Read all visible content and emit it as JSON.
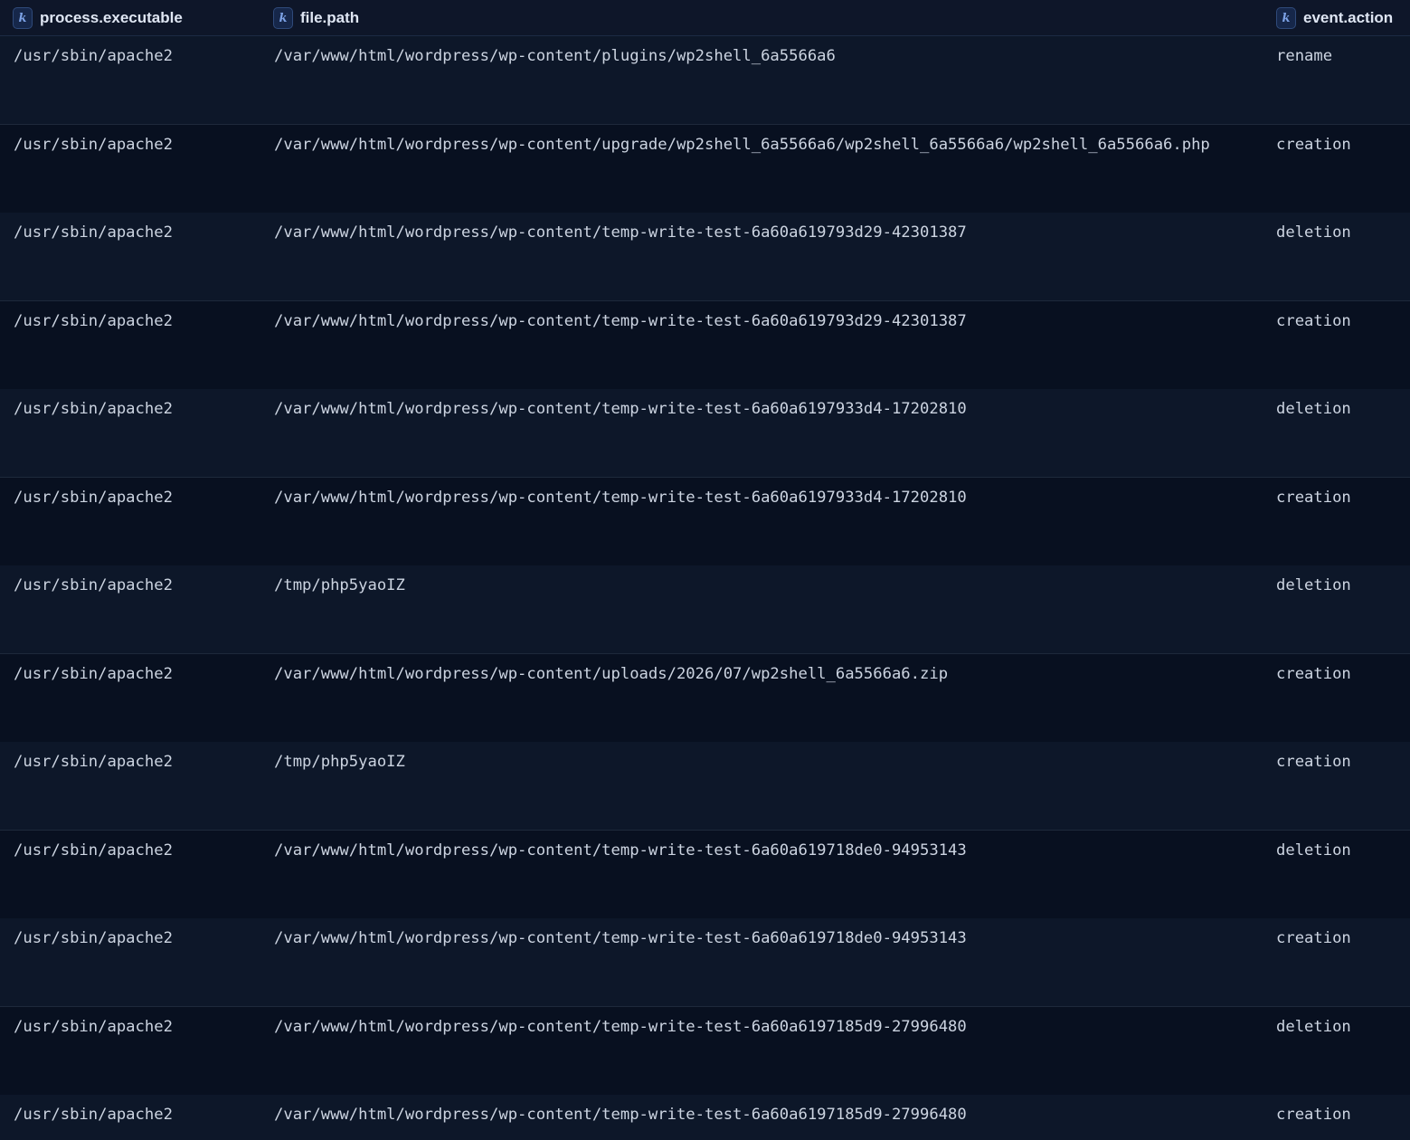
{
  "table": {
    "columns": [
      {
        "key": "process.executable",
        "type_badge": "k",
        "type_icon": "keyword-type-icon"
      },
      {
        "key": "file.path",
        "type_badge": "k",
        "type_icon": "keyword-type-icon"
      },
      {
        "key": "event.action",
        "type_badge": "k",
        "type_icon": "keyword-type-icon"
      }
    ],
    "rows": [
      {
        "process_executable": "/usr/sbin/apache2",
        "file_path": "/var/www/html/wordpress/wp-content/plugins/wp2shell_6a5566a6",
        "event_action": "rename"
      },
      {
        "process_executable": "/usr/sbin/apache2",
        "file_path": "/var/www/html/wordpress/wp-content/upgrade/wp2shell_6a5566a6/wp2shell_6a5566a6/wp2shell_6a5566a6.php",
        "event_action": "creation"
      },
      {
        "process_executable": "/usr/sbin/apache2",
        "file_path": "/var/www/html/wordpress/wp-content/temp-write-test-6a60a619793d29-42301387",
        "event_action": "deletion"
      },
      {
        "process_executable": "/usr/sbin/apache2",
        "file_path": "/var/www/html/wordpress/wp-content/temp-write-test-6a60a619793d29-42301387",
        "event_action": "creation"
      },
      {
        "process_executable": "/usr/sbin/apache2",
        "file_path": "/var/www/html/wordpress/wp-content/temp-write-test-6a60a6197933d4-17202810",
        "event_action": "deletion"
      },
      {
        "process_executable": "/usr/sbin/apache2",
        "file_path": "/var/www/html/wordpress/wp-content/temp-write-test-6a60a6197933d4-17202810",
        "event_action": "creation"
      },
      {
        "process_executable": "/usr/sbin/apache2",
        "file_path": "/tmp/php5yaoIZ",
        "event_action": "deletion"
      },
      {
        "process_executable": "/usr/sbin/apache2",
        "file_path": "/var/www/html/wordpress/wp-content/uploads/2026/07/wp2shell_6a5566a6.zip",
        "event_action": "creation"
      },
      {
        "process_executable": "/usr/sbin/apache2",
        "file_path": "/tmp/php5yaoIZ",
        "event_action": "creation"
      },
      {
        "process_executable": "/usr/sbin/apache2",
        "file_path": "/var/www/html/wordpress/wp-content/temp-write-test-6a60a619718de0-94953143",
        "event_action": "deletion"
      },
      {
        "process_executable": "/usr/sbin/apache2",
        "file_path": "/var/www/html/wordpress/wp-content/temp-write-test-6a60a619718de0-94953143",
        "event_action": "creation"
      },
      {
        "process_executable": "/usr/sbin/apache2",
        "file_path": "/var/www/html/wordpress/wp-content/temp-write-test-6a60a6197185d9-27996480",
        "event_action": "deletion"
      },
      {
        "process_executable": "/usr/sbin/apache2",
        "file_path": "/var/www/html/wordpress/wp-content/temp-write-test-6a60a6197185d9-27996480",
        "event_action": "creation"
      }
    ]
  },
  "colors": {
    "background": "#0f172a",
    "row_odd": "#0d1729",
    "row_even": "#081020",
    "text": "#ccd4e1",
    "header_text": "#dfe6f3",
    "badge_text": "#7da2e6"
  }
}
